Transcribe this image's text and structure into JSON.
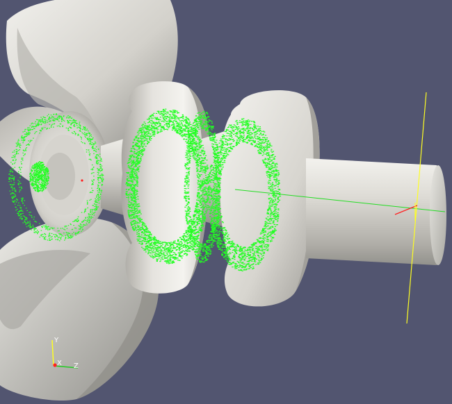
{
  "viewport": {
    "background_color": "#525570",
    "geometry_color": "#d8d6d0",
    "particle_color": "#22ff22",
    "probe_line_color": "#22dd22",
    "center_axis_x_color": "#ff2222",
    "center_axis_y_color": "#ffff22"
  },
  "orientation_axes": {
    "x_label": "X",
    "y_label": "Y",
    "z_label": "Z",
    "x_color": "#ff2222",
    "y_color": "#ffff22",
    "z_color": "#22cc22"
  }
}
